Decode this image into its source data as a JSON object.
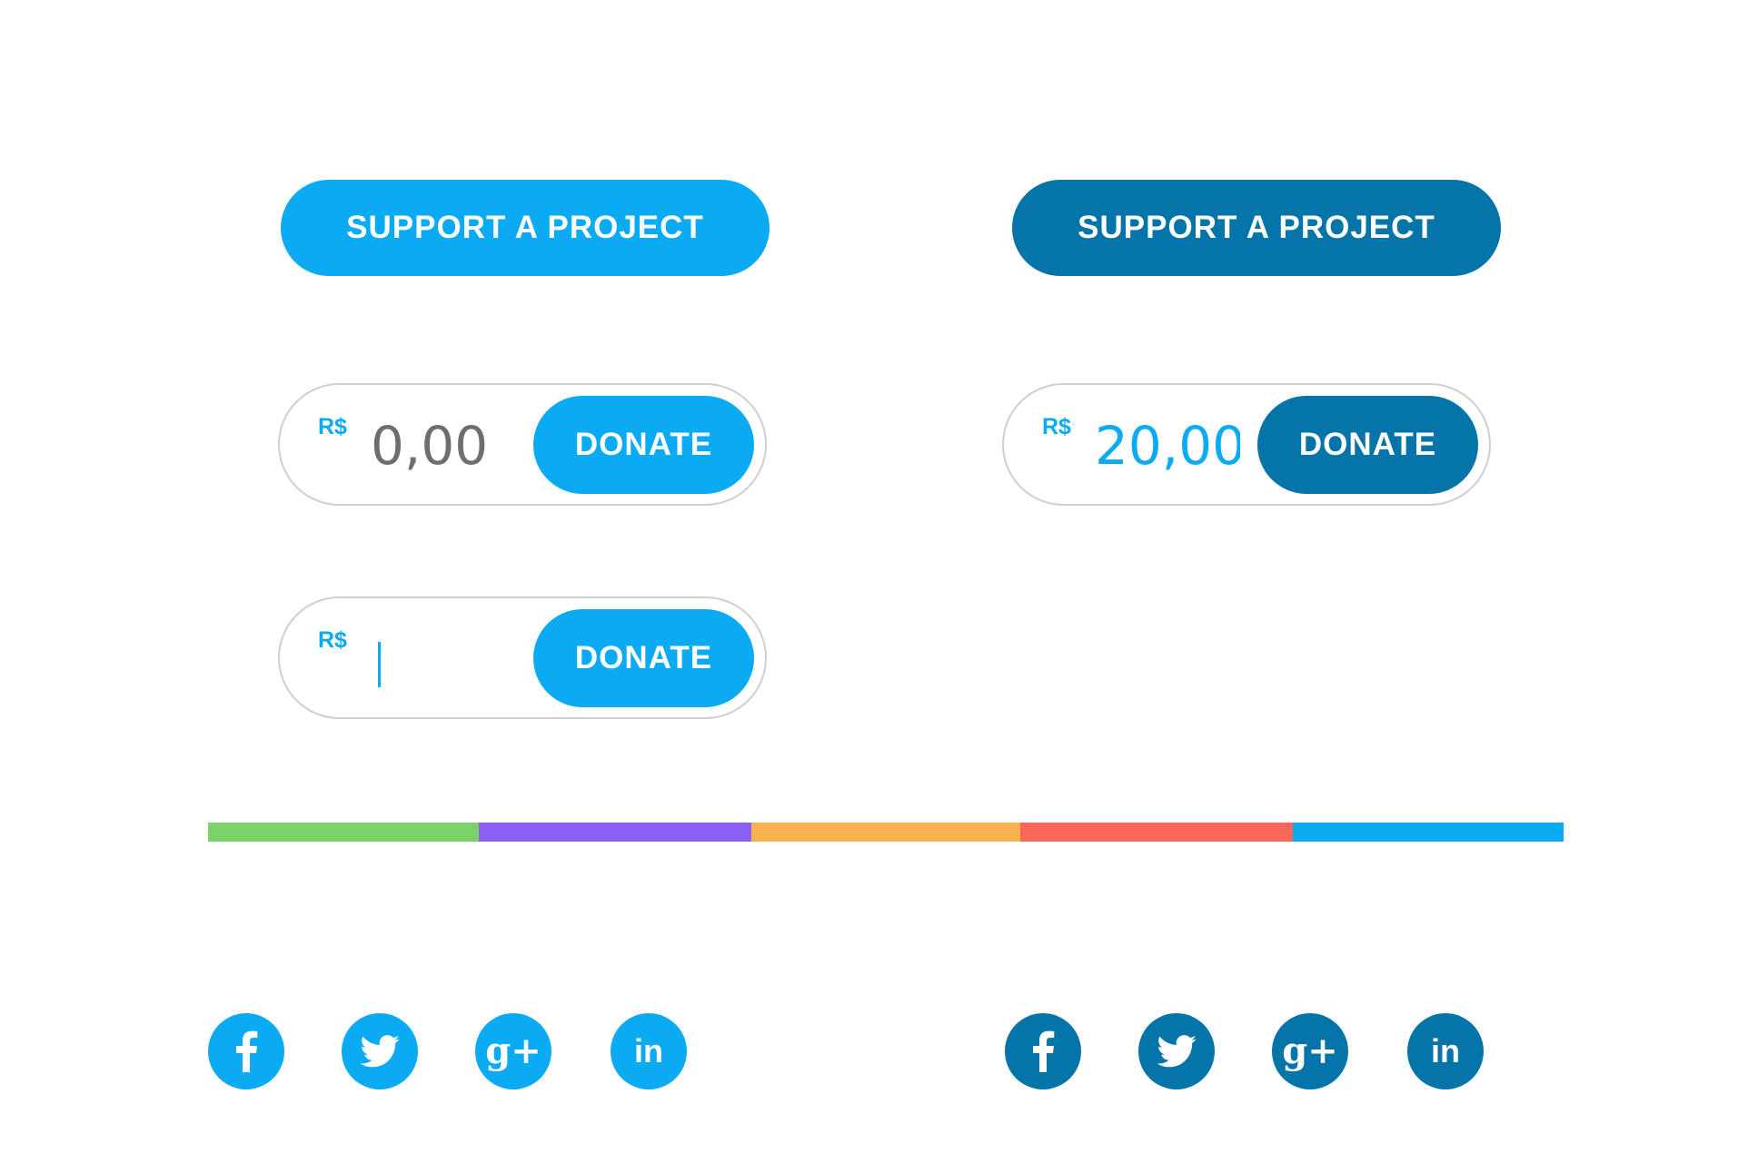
{
  "colors": {
    "primary": "#0aabf2",
    "dark": "#0574a8",
    "amount_placeholder": "#6e6e6e",
    "border": "#cfcfcf",
    "bar": [
      "#7ad268",
      "#8c5ff5",
      "#f9b24e",
      "#f86858",
      "#0aabf2"
    ]
  },
  "support_buttons": [
    {
      "label": "SUPPORT A PROJECT",
      "state": "default"
    },
    {
      "label": "SUPPORT A PROJECT",
      "state": "hover"
    }
  ],
  "donate_widgets": [
    {
      "currency": "R$",
      "amount": "",
      "placeholder": "0,00",
      "button": "DONATE",
      "state": "default"
    },
    {
      "currency": "R$",
      "amount": "20,00",
      "placeholder": "",
      "button": "DONATE",
      "state": "filled-hover"
    },
    {
      "currency": "R$",
      "amount": "",
      "placeholder": "",
      "button": "DONATE",
      "state": "focused"
    }
  ],
  "social": {
    "icons": [
      "facebook-icon",
      "twitter-icon",
      "google-plus-icon",
      "linkedin-icon"
    ],
    "gplus_glyph": "g+",
    "linkedin_glyph": "in"
  }
}
